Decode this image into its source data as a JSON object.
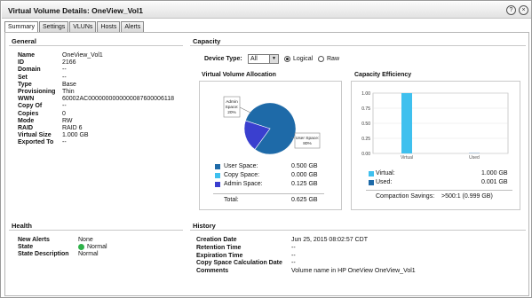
{
  "window": {
    "title": "Virtual Volume Details: OneView_Vol1"
  },
  "tabs": [
    "Summary",
    "Settings",
    "VLUNs",
    "Hosts",
    "Alerts"
  ],
  "general": {
    "title": "General",
    "rows": [
      {
        "k": "Name",
        "v": "OneView_Vol1"
      },
      {
        "k": "ID",
        "v": "2166"
      },
      {
        "k": "Domain",
        "v": "--"
      },
      {
        "k": "Set",
        "v": "--"
      },
      {
        "k": "Type",
        "v": "Base"
      },
      {
        "k": "Provisioning",
        "v": "Thin"
      },
      {
        "k": "WWN",
        "v": "60002AC0000000000000087600006118"
      },
      {
        "k": "Copy Of",
        "v": "--"
      },
      {
        "k": "Copies",
        "v": "0"
      },
      {
        "k": "Mode",
        "v": "RW"
      },
      {
        "k": "RAID",
        "v": "RAID 6"
      },
      {
        "k": "Virtual Size",
        "v": "1.000 GB"
      },
      {
        "k": "Exported To",
        "v": "--"
      }
    ]
  },
  "capacity": {
    "title": "Capacity",
    "device_type_label": "Device Type:",
    "device_type_value": "All",
    "radio_logical": "Logical",
    "radio_raw": "Raw",
    "allocation": {
      "title": "Virtual Volume Allocation",
      "callout_admin": "Admin Space: 20%",
      "callout_user": "User Space: 80%",
      "legend": [
        {
          "label": "User Space:",
          "value": "0.500 GB",
          "color": "#1e6aa8"
        },
        {
          "label": "Copy Space:",
          "value": "0.000 GB",
          "color": "#3fc0ee"
        },
        {
          "label": "Admin Space:",
          "value": "0.125 GB",
          "color": "#3a3fcf"
        }
      ],
      "total_label": "Total:",
      "total_value": "0.625 GB"
    },
    "efficiency": {
      "title": "Capacity Efficiency",
      "legend": [
        {
          "label": "Virtual:",
          "value": "1.000 GB",
          "color": "#3fc0ee"
        },
        {
          "label": "Used:",
          "value": "0.001 GB",
          "color": "#1e6aa8"
        }
      ],
      "savings_label": "Compaction Savings:",
      "savings_value": ">500:1 (0.999 GB)"
    }
  },
  "health": {
    "title": "Health",
    "rows": [
      {
        "k": "New Alerts",
        "v": "None"
      },
      {
        "k": "State",
        "v": "Normal"
      },
      {
        "k": "State Description",
        "v": "Normal"
      }
    ],
    "state_color": "#2fb24a"
  },
  "history": {
    "title": "History",
    "rows": [
      {
        "k": "Creation Date",
        "v": "Jun 25, 2015 08:02:57 CDT"
      },
      {
        "k": "Retention Time",
        "v": "--"
      },
      {
        "k": "Expiration Time",
        "v": "--"
      },
      {
        "k": "Copy Space Calculation Date",
        "v": "--"
      },
      {
        "k": "Comments",
        "v": "Volume name in HP OneView OneView_Vol1"
      }
    ]
  },
  "chart_data": [
    {
      "type": "pie",
      "title": "Virtual Volume Allocation",
      "labels": [
        "User Space",
        "Admin Space"
      ],
      "values": [
        80,
        20
      ],
      "colors": [
        "#1e6aa8",
        "#3a3fcf"
      ],
      "annotations": [
        "Admin Space: 20%",
        "User Space: 80%"
      ]
    },
    {
      "type": "bar",
      "title": "Capacity Efficiency",
      "categories": [
        "Virtual",
        "Used"
      ],
      "values": [
        1.0,
        0.001
      ],
      "colors": [
        "#3fc0ee",
        "#1e6aa8"
      ],
      "ylim": [
        0,
        1.0
      ],
      "yticks": [
        "0.00",
        "0.25",
        "0.50",
        "0.75",
        "1.00"
      ]
    }
  ]
}
